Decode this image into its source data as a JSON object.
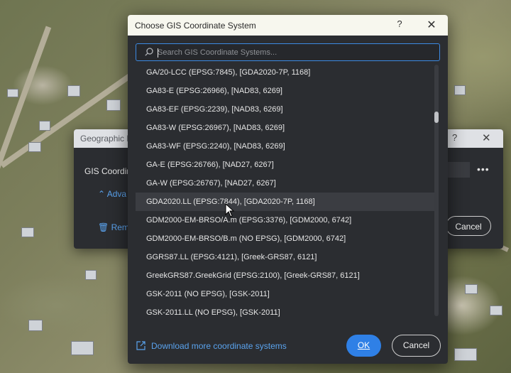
{
  "main_dialog": {
    "title": "Choose GIS Coordinate System",
    "help_label": "?",
    "close_label": "✕",
    "search": {
      "placeholder": "Search GIS Coordinate Systems...",
      "value": ""
    },
    "items": [
      "GA/20-LCC (EPSG:7845), [GDA2020-7P, 1168]",
      "GA83-E (EPSG:26966), [NAD83, 6269]",
      "GA83-EF (EPSG:2239), [NAD83, 6269]",
      "GA83-W (EPSG:26967), [NAD83, 6269]",
      "GA83-WF (EPSG:2240), [NAD83, 6269]",
      "GA-E (EPSG:26766), [NAD27, 6267]",
      "GA-W (EPSG:26767), [NAD27, 6267]",
      "GDA2020.LL (EPSG:7844), [GDA2020-7P, 1168]",
      "GDM2000-EM-BRSO/A.m (EPSG:3376), [GDM2000, 6742]",
      "GDM2000-EM-BRSO/B.m (NO EPSG), [GDM2000, 6742]",
      "GGRS87.LL (EPSG:4121), [Greek-GRS87, 6121]",
      "GreekGRS87.GreekGrid (EPSG:2100), [Greek-GRS87, 6121]",
      "GSK-2011 (NO EPSG), [GSK-2011]",
      "GSK-2011.LL (NO EPSG), [GSK-2011]"
    ],
    "highlighted_index": 7,
    "download_link": "Download more coordinate systems",
    "ok_label": "OK",
    "cancel_label": "Cancel",
    "accent_color": "#2f80e6"
  },
  "bg_dialog": {
    "title": "Geographic L",
    "help_label": "?",
    "close_label": "✕",
    "label": "GIS Coordin",
    "more_label": "•••",
    "advanced_label": "Adva",
    "remove_label": "Rem",
    "cancel_label": "Cancel"
  }
}
